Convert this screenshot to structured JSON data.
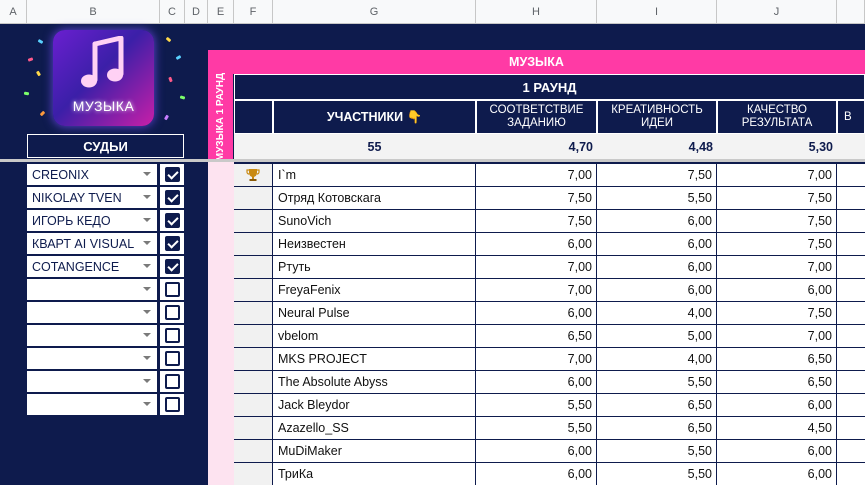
{
  "columns": [
    "A",
    "B",
    "C",
    "D",
    "E",
    "F",
    "G",
    "H",
    "I",
    "J"
  ],
  "logo": {
    "title": "МУЗЫКА",
    "icon": "music-note-icon"
  },
  "section_title": "МУЗЫКА",
  "round_title": "1 РАУНД",
  "vertical_label": "МУЗЫКА 1 РАУНД",
  "judges": {
    "title": "СУДЬИ",
    "items": [
      {
        "name": "CREONIX",
        "checked": true
      },
      {
        "name": "NIKOLAY TVEN",
        "checked": true
      },
      {
        "name": "ИГОРЬ КЕДО",
        "checked": true
      },
      {
        "name": "КВАРТ AI VISUAL",
        "checked": true
      },
      {
        "name": "COTANGENCE",
        "checked": true
      },
      {
        "name": "",
        "checked": false
      },
      {
        "name": "",
        "checked": false
      },
      {
        "name": "",
        "checked": false
      },
      {
        "name": "",
        "checked": false
      },
      {
        "name": "",
        "checked": false
      },
      {
        "name": "",
        "checked": false
      }
    ]
  },
  "table": {
    "headers": {
      "participants": "УЧАСТНИКИ 👇",
      "c1": "СООТВЕТСТВИЕ ЗАДАНИЮ",
      "c2": "КРЕАТИВНОСТЬ ИДЕИ",
      "c3": "КАЧЕСТВО РЕЗУЛЬТАТА",
      "c4": "В"
    },
    "summary": {
      "count": "55",
      "c1": "4,70",
      "c2": "4,48",
      "c3": "5,30"
    },
    "rows": [
      {
        "icon": "trophy-icon",
        "name": "I`m",
        "v1": "7,00",
        "v2": "7,50",
        "v3": "7,00"
      },
      {
        "icon": "",
        "name": "Отряд Котовскага",
        "v1": "7,50",
        "v2": "5,50",
        "v3": "7,50"
      },
      {
        "icon": "",
        "name": "SunoVich",
        "v1": "7,50",
        "v2": "6,00",
        "v3": "7,50"
      },
      {
        "icon": "",
        "name": "Неизвестен",
        "v1": "6,00",
        "v2": "6,00",
        "v3": "7,50"
      },
      {
        "icon": "",
        "name": "Ртуть",
        "v1": "7,00",
        "v2": "6,00",
        "v3": "7,00"
      },
      {
        "icon": "",
        "name": "FreyaFenix",
        "v1": "7,00",
        "v2": "6,00",
        "v3": "6,00"
      },
      {
        "icon": "",
        "name": "Neural Pulse",
        "v1": "6,00",
        "v2": "4,00",
        "v3": "7,50"
      },
      {
        "icon": "",
        "name": "vbelom",
        "v1": "6,50",
        "v2": "5,00",
        "v3": "7,00"
      },
      {
        "icon": "",
        "name": "MKS PROJECT",
        "v1": "7,00",
        "v2": "4,00",
        "v3": "6,50"
      },
      {
        "icon": "",
        "name": "The Absolute Abyss",
        "v1": "6,00",
        "v2": "5,50",
        "v3": "6,50"
      },
      {
        "icon": "",
        "name": "Jack Bleydor",
        "v1": "5,50",
        "v2": "6,50",
        "v3": "6,00"
      },
      {
        "icon": "",
        "name": "Azazello_SS",
        "v1": "5,50",
        "v2": "6,50",
        "v3": "4,50"
      },
      {
        "icon": "",
        "name": "MuDiMaker",
        "v1": "6,00",
        "v2": "5,50",
        "v3": "6,00"
      },
      {
        "icon": "",
        "name": "ТриКа",
        "v1": "6,00",
        "v2": "5,50",
        "v3": "6,00"
      }
    ]
  },
  "colors": {
    "navy": "#0e1b4d",
    "pink": "#ff3aa5",
    "light_pink": "#fde3f0"
  }
}
